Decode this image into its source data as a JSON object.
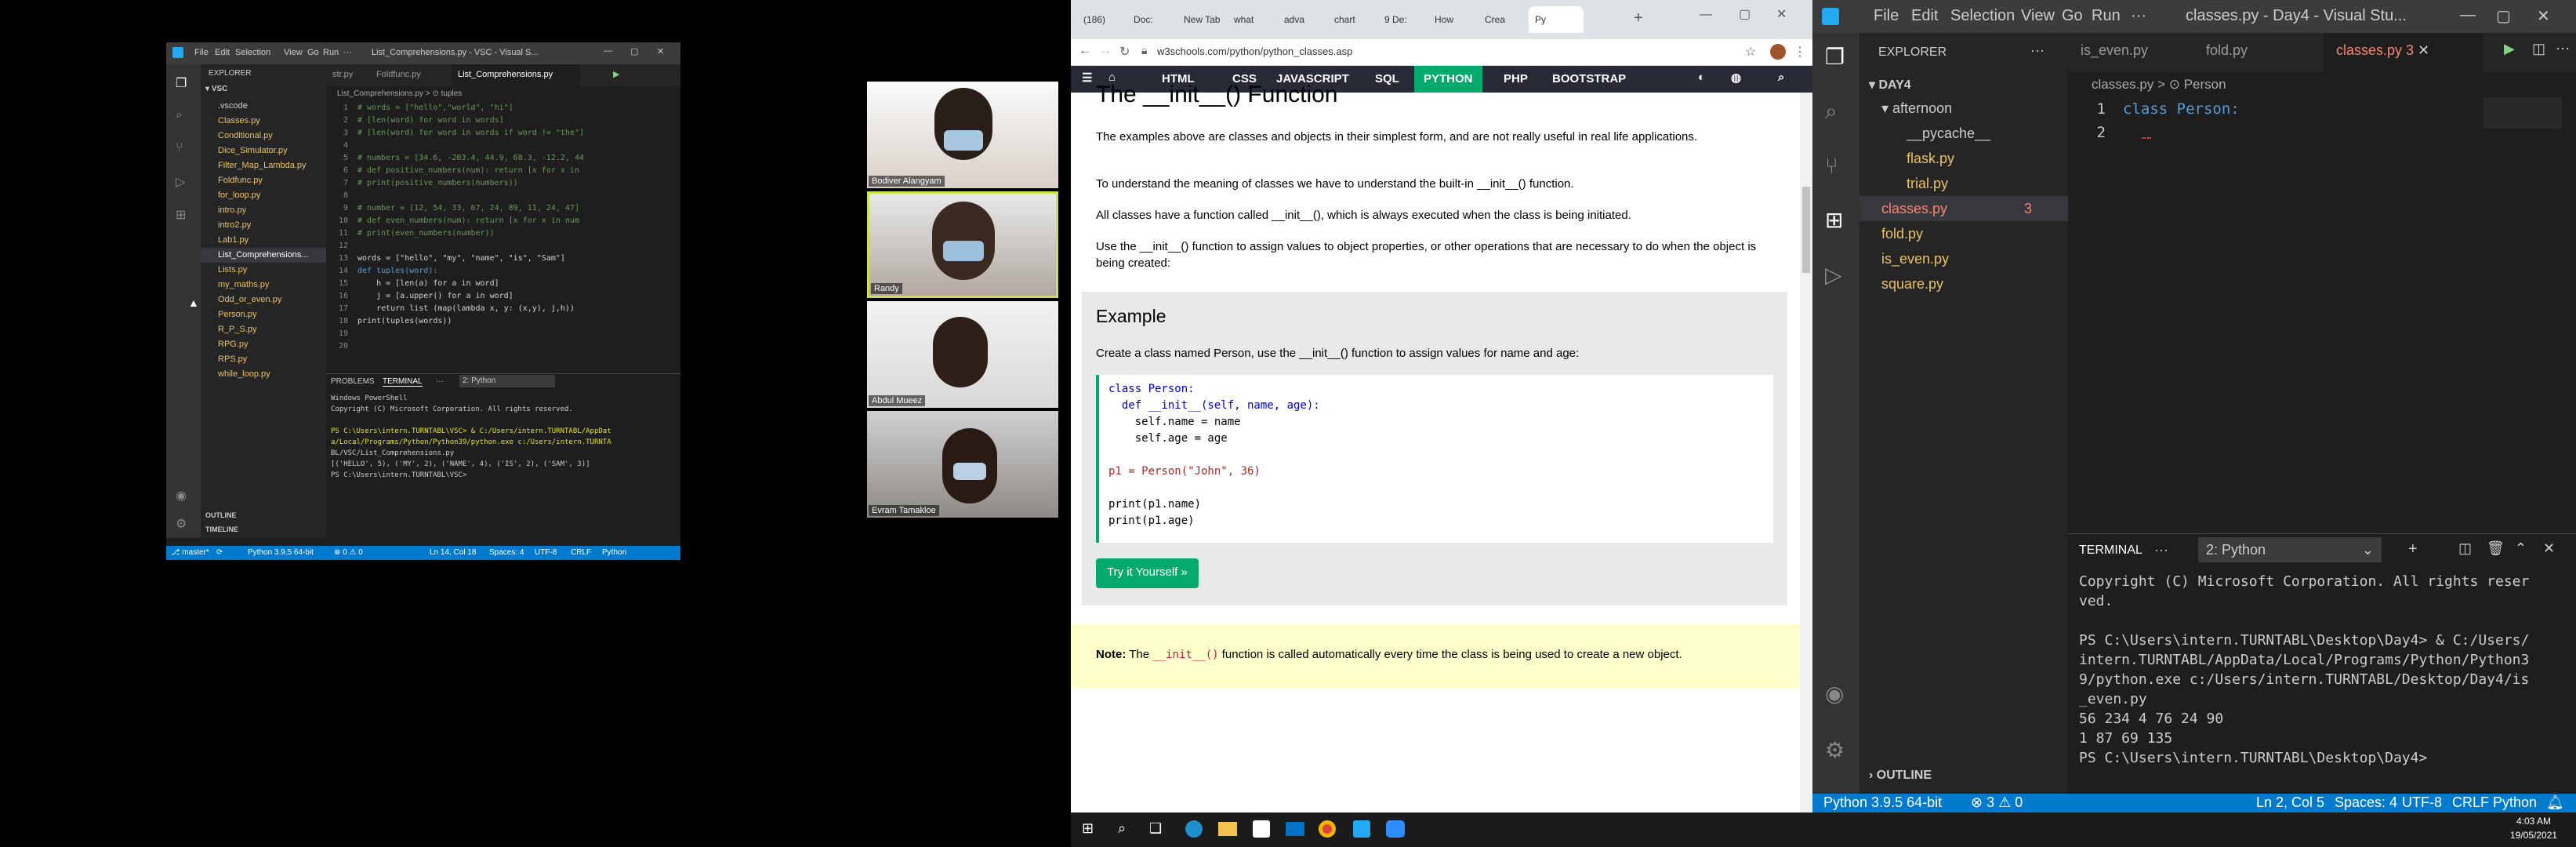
{
  "left_vscode": {
    "title": "List_Comprehensions.py - VSC - Visual S...",
    "menu": [
      "File",
      "Edit",
      "Selection",
      "View",
      "Go",
      "Run",
      "···"
    ],
    "explorer_header": "EXPLORER",
    "folder": "VSC",
    "files": [
      ".vscode",
      "Classes.py",
      "Conditional.py",
      "Dice_Simulator.py",
      "Filter_Map_Lambda.py",
      "Foldfunc.py",
      "for_loop.py",
      "intro.py",
      "intro2.py",
      "Lab1.py",
      "List_Comprehensions...",
      "Lists.py",
      "my_maths.py",
      "Odd_or_even.py",
      "Person.py",
      "R_P_S.py",
      "RPG.py",
      "RPS.py",
      "while_loop.py"
    ],
    "outline": "OUTLINE",
    "timeline": "TIMELINE",
    "tabs": [
      "str.py",
      "Foldfunc.py",
      "List_Comprehensions.py"
    ],
    "breadcrumb": "List_Comprehensions.py > ⊙ tuples",
    "code": [
      {
        "n": "1",
        "t": "# words = [\"hello\",\"world\", \"hi\"]",
        "c": "cm"
      },
      {
        "n": "2",
        "t": "# [len(word) for word in words]",
        "c": "cm"
      },
      {
        "n": "3",
        "t": "# [len(word) for word in words if word != \"the\"]",
        "c": "cm"
      },
      {
        "n": "4",
        "t": "",
        "c": ""
      },
      {
        "n": "5",
        "t": "# numbers = [34.6, -203.4, 44.9, 68.3, -12.2, 44",
        "c": "cm"
      },
      {
        "n": "6",
        "t": "# def positive_numbers(num): return [x for x in",
        "c": "cm"
      },
      {
        "n": "7",
        "t": "# print(positive_numbers(numbers))",
        "c": "cm"
      },
      {
        "n": "8",
        "t": "",
        "c": ""
      },
      {
        "n": "9",
        "t": "# number = [12, 54, 33, 67, 24, 89, 11, 24, 47]",
        "c": "cm"
      },
      {
        "n": "10",
        "t": "# def even_numbers(num): return [x for x in num",
        "c": "cm"
      },
      {
        "n": "11",
        "t": "# print(even_numbers(number))",
        "c": "cm"
      },
      {
        "n": "12",
        "t": "",
        "c": ""
      },
      {
        "n": "13",
        "t": "words = [\"hello\", \"my\", \"name\", \"is\", \"Sam\"]",
        "c": ""
      },
      {
        "n": "14",
        "t": "def tuples(word):",
        "c": "kw"
      },
      {
        "n": "15",
        "t": "    h = [len(a) for a in word]",
        "c": ""
      },
      {
        "n": "16",
        "t": "    j = [a.upper() for a in word]",
        "c": ""
      },
      {
        "n": "17",
        "t": "    return list (map(lambda x, y: (x,y), j,h))",
        "c": ""
      },
      {
        "n": "18",
        "t": "print(tuples(words))",
        "c": ""
      },
      {
        "n": "19",
        "t": "",
        "c": ""
      },
      {
        "n": "20",
        "t": "",
        "c": ""
      }
    ],
    "panel_tabs": [
      "PROBLEMS",
      "TERMINAL",
      "···"
    ],
    "terminal_select": "2: Python",
    "terminal": [
      "Windows PowerShell",
      "Copyright (C) Microsoft Corporation. All rights reserved.",
      "",
      "PS C:\\Users\\intern.TURNTABL\\VSC> & C:/Users/intern.TURNTABL/AppDat",
      "a/Local/Programs/Python/Python39/python.exe c:/Users/intern.TURNTA",
      "BL/VSC/List_Comprehensions.py",
      "[('HELLO', 5), ('MY', 2), ('NAME', 4), ('IS', 2), ('SAM', 3)]",
      "PS C:\\Users\\intern.TURNTABL\\VSC>"
    ],
    "status_left": [
      "⎇ master*",
      "⟳",
      "Python 3.9.5 64-bit",
      "⊗ 0 ⚠ 0"
    ],
    "status_right": [
      "Ln 14, Col 18",
      "Spaces: 4",
      "UTF-8",
      "CRLF",
      "Python"
    ]
  },
  "participants": [
    "Bodiver Alangyam",
    "Randy",
    "Abdul Mueez",
    "Evram Tamakloe"
  ],
  "browser": {
    "tabs": [
      "(186)",
      "Doc:",
      "New Tab",
      "what",
      "adva",
      "chart",
      "9 De:",
      "How",
      "Crea",
      "Py"
    ],
    "url": "w3schools.com/python/python_classes.asp",
    "nav": [
      "HTML",
      "CSS",
      "JAVASCRIPT",
      "SQL",
      "PYTHON",
      "PHP",
      "BOOTSTRAP"
    ],
    "heading": "The __init__() Function",
    "p1": "The examples above are classes and objects in their simplest form, and are not really useful in real life applications.",
    "p2": "To understand the meaning of classes we have to understand the built-in __init__() function.",
    "p3": "All classes have a function called __init__(), which is always executed when the class is being initiated.",
    "p4": "Use the __init__() function to assign values to object properties, or other operations that are necessary to do when the object is being created:",
    "example_title": "Example",
    "example_text": "Create a class named Person, use the __init__() function to assign values for name and age:",
    "code": [
      "class Person:",
      "  def __init__(self, name, age):",
      "    self.name = name",
      "    self.age = age",
      "",
      "p1 = Person(\"John\", 36)",
      "",
      "print(p1.name)",
      "print(p1.age)"
    ],
    "try_button": "Try it Yourself »",
    "note_label": "Note:",
    "note_pre": "The",
    "note_code": "__init__()",
    "note_post": "function is called automatically every time the class is being used to create a new object."
  },
  "right_vscode": {
    "menu": [
      "File",
      "Edit",
      "Selection",
      "View",
      "Go",
      "Run",
      "···"
    ],
    "title": "classes.py - Day4 - Visual Stu...",
    "explorer_header": "EXPLORER",
    "folder": "DAY4",
    "subfolder": "afternoon",
    "sub_items": [
      "__pycache__",
      "flask.py",
      "trial.py"
    ],
    "files": [
      "classes.py",
      "fold.py",
      "is_even.py",
      "square.py"
    ],
    "error_count": "3",
    "outline": "OUTLINE",
    "tabs": [
      "is_even.py",
      "fold.py",
      "classes.py 3"
    ],
    "breadcrumb": "classes.py > ⊙ Person",
    "code": [
      {
        "n": "1",
        "t": "class Person:"
      },
      {
        "n": "2",
        "t": ""
      }
    ],
    "terminal_tab": "TERMINAL",
    "terminal_select": "2: Python",
    "terminal": [
      "Copyright (C) Microsoft Corporation. All rights reser",
      "ved.",
      "",
      "PS C:\\Users\\intern.TURNTABL\\Desktop\\Day4> & C:/Users/",
      "intern.TURNTABL/AppData/Local/Programs/Python/Python3",
      "9/python.exe c:/Users/intern.TURNTABL/Desktop/Day4/is",
      "_even.py",
      "56 234 4 76 24 90",
      "1 87 69 135",
      "PS C:\\Users\\intern.TURNTABL\\Desktop\\Day4>"
    ],
    "status_left": [
      "Python 3.9.5 64-bit",
      "⊗ 3 ⚠ 0"
    ],
    "status_right": [
      "Ln 2, Col 5",
      "Spaces: 4",
      "UTF-8",
      "CRLF",
      "Python"
    ]
  },
  "taskbar": {
    "time": "4:03 AM",
    "date": "19/05/2021"
  }
}
